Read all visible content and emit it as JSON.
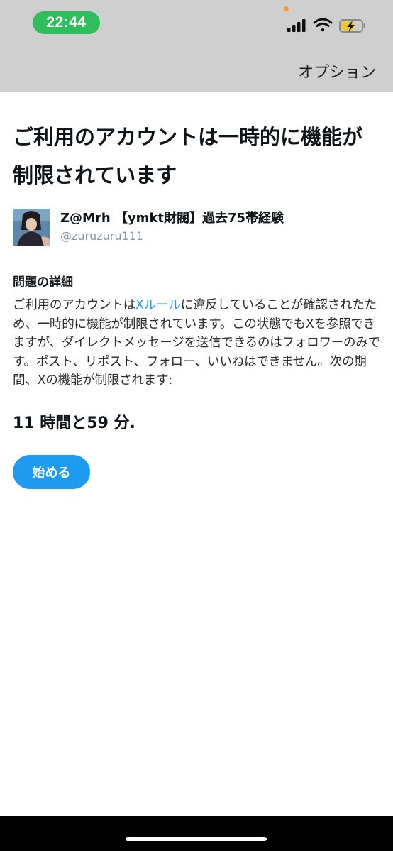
{
  "status_bar": {
    "time": "22:44",
    "pill_color": "#2fbe5c",
    "icons": [
      "signal-icon",
      "wifi-icon",
      "battery-charging-icon"
    ]
  },
  "header": {
    "options_label": "オプション"
  },
  "notice": {
    "title_line1": "ご利用のアカウントは一時的に機能が",
    "title_line2": "制限されています"
  },
  "account": {
    "name": "Z@Mrh 【ymkt財閥】過去75帯経験",
    "handle": "@zuruzuru111"
  },
  "details": {
    "section_title": "問題の詳細",
    "text_before_link": "ご利用のアカウントは",
    "link_text": "Xルール",
    "text_after_link": "に違反していることが確認されたため、一時的に機能が制限されています。この状態でもXを参照できますが、ダイレクトメッセージを送信できるのはフォロワーのみです。ポスト、リポスト、フォロー、いいねはできません。次の期間、Xの機能が制限されます:"
  },
  "duration": "11 時間と59 分.",
  "actions": {
    "start_label": "始める"
  },
  "colors": {
    "accent": "#1d9bf0",
    "top_bar": "#cfcfcf"
  }
}
